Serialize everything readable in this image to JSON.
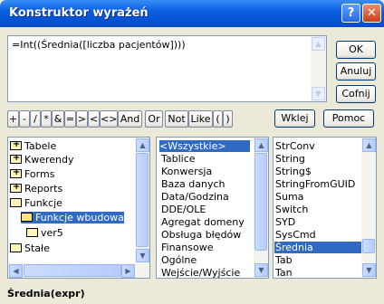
{
  "window": {
    "title": "Konstruktor wyrażeń"
  },
  "expression": {
    "value": "=Int((Średnia([liczba pacjentów])))"
  },
  "buttons": {
    "ok": "OK",
    "cancel": "Anuluj",
    "undo": "Cofnij",
    "paste": "Wklej",
    "help": "Pomoc"
  },
  "operators": [
    "+",
    "-",
    "/",
    "*",
    "&",
    "=",
    ">",
    "<",
    "<>",
    "And",
    "Or",
    "Not",
    "Like",
    "(",
    ")"
  ],
  "tree": {
    "items": [
      "Tabele",
      "Kwerendy",
      "Forms",
      "Reports",
      "Funkcje",
      "Funkcje wbudowa",
      "ver5",
      "Stałe"
    ]
  },
  "categories": {
    "items": [
      "<Wszystkie>",
      "Tablice",
      "Konwersja",
      "Baza danych",
      "Data/Godzina",
      "DDE/OLE",
      "Agregat domeny",
      "Obsługa błędów",
      "Finansowe",
      "Ogólne",
      "Wejście/Wyjście"
    ]
  },
  "functions": {
    "items": [
      "StrConv",
      "String",
      "String$",
      "StringFromGUID",
      "Suma",
      "Switch",
      "SYD",
      "SysCmd",
      "Średnia",
      "Tab",
      "Tan"
    ]
  },
  "status": {
    "syntax": "Średnia(expr)"
  },
  "colors": {
    "selection": "#316ac5",
    "titlebar": "#0654d6"
  }
}
